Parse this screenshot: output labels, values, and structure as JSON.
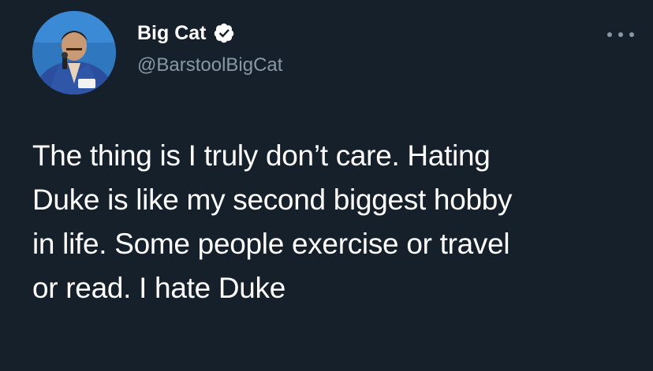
{
  "author": {
    "display_name": "Big Cat",
    "handle": "@BarstoolBigCat",
    "verified": true,
    "avatar_icon": "profile-photo"
  },
  "more_icon": "more-options-icon",
  "tweet": {
    "lines": [
      "The thing is I truly don’t care. Hating",
      "Duke is like my second biggest hobby",
      "in life. Some people exercise or travel",
      "or read. I hate Duke"
    ]
  },
  "colors": {
    "background": "#15202b",
    "text": "#ffffff",
    "secondary_text": "#8899a6",
    "verified_badge": "#ffffff"
  }
}
